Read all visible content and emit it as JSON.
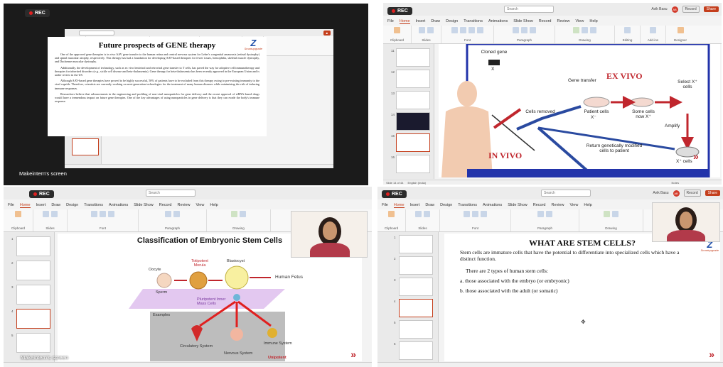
{
  "panel1": {
    "rec_label": "REC",
    "screen_label": "Makeintern's screen",
    "slide": {
      "title": "Future prospects of GENE therapy",
      "paragraphs": [
        "One of the approved gene therapies is in vivo AAV gene transfer to the human retina and central nervous system for Leber's congenital amaurosis (retinal dystrophy) and spinal muscular atrophy, respectively. This therapy has had a foundation for developing AAV-based therapies for fewer issues, hemophilia, skeletal muscle dystrophy, and Duchenne muscular dystrophy.",
        "Additionally, the development of technology, such as ex vivo lentiviral and retroviral gene transfer to T cells, has paved the way for adoptive cell immunotherapy and therapies for inherited disorders (e.g., sickle cell disease and beta-thalassemia). Gene therapy for beta-thalassemia has been recently approved in the European Union and is under review in the US.",
        "Although AAV-based gene therapies have proved to be highly successful, 50% of patients have to be excluded from this therapy owing to pre-existing immunity to the viral capsids. Therefore, scientists are currently working on next-generation technologies for the treatment of many human diseases while minimizing the risk of inducing immune responses.",
        "Researchers believe that advancements in the engineering and profiling of non-viral nanoparticles for gene delivery and the recent approval of siRNA-based drugs would have a tremendous impact on future gene therapies. One of the key advantages of using nanoparticles in gene delivery is that they can evade the body's immune response."
      ],
      "logo_text": "Smartupgrade"
    }
  },
  "panel2": {
    "rec_label": "REC",
    "search_placeholder": "Search",
    "user_name": "Avik Basu",
    "record_label": "Record",
    "share_label": "Share",
    "menu": [
      "File",
      "Home",
      "Insert",
      "Draw",
      "Design",
      "Transitions",
      "Animations",
      "Slide Show",
      "Record",
      "Review",
      "View",
      "Help"
    ],
    "ribbon_groups": [
      "Clipboard",
      "Slides",
      "Font",
      "Paragraph",
      "Drawing",
      "Editing",
      "Add-ins",
      "Designer"
    ],
    "slide_numbers": [
      "11",
      "12",
      "13",
      "14",
      "15",
      "16"
    ],
    "slide": {
      "cloned_gene": "Cloned gene",
      "x_mark": "X",
      "gene_transfer": "Gene transfer",
      "ex_vivo": "EX VIVO",
      "select": "Select X⁺ cells",
      "cells_removed": "Cells removed",
      "patient_cells": "Patient cells",
      "x_minus": "X⁻",
      "some_cells": "Some cells now X⁺",
      "amplify": "Amplify",
      "return_text": "Return genetically modified cells to patient",
      "in_vivo": "IN VIVO",
      "x_plus_cells": "X⁺ cells"
    },
    "status_left": "Slide 14 of 44",
    "status_lang": "English (India)",
    "status_notes": "Notes"
  },
  "panel3": {
    "rec_label": "REC",
    "search_placeholder": "Search",
    "menu": [
      "File",
      "Home",
      "Insert",
      "Draw",
      "Design",
      "Transitions",
      "Animations",
      "Slide Show",
      "Record",
      "Review",
      "View",
      "Help"
    ],
    "ribbon_groups": [
      "Clipboard",
      "Slides",
      "Font",
      "Paragraph",
      "Drawing"
    ],
    "slide_numbers": [
      "1",
      "2",
      "3",
      "4",
      "5"
    ],
    "slide": {
      "title": "Classification of Embryonic Stem Cells",
      "oocyte": "Oocyte",
      "sperm": "Sperm",
      "totipotent": "Totipotent Morula",
      "blastocyst": "Blastocyst",
      "human_fetus": "Human Fetus",
      "pluripotent": "Pluripotent Inner Mass Cells",
      "examples": "Examples",
      "circulatory": "Circulatory System",
      "nervous": "Nervous System",
      "immune": "Immune System",
      "unipotent": "Unipotent",
      "logo_text": "Smartupgrade"
    },
    "screen_label": "Makeintern's screen"
  },
  "panel4": {
    "rec_label": "REC",
    "search_placeholder": "Search",
    "user_name": "Avik Basu",
    "record_label": "Record",
    "share_label": "Share",
    "menu": [
      "File",
      "Home",
      "Insert",
      "Draw",
      "Design",
      "Transitions",
      "Animations",
      "Slide Show",
      "Record",
      "Review",
      "View",
      "Help"
    ],
    "ribbon_groups": [
      "Clipboard",
      "Slides",
      "Font",
      "Paragraph",
      "Drawing"
    ],
    "slide_numbers": [
      "1",
      "2",
      "3",
      "4",
      "5",
      "6"
    ],
    "slide": {
      "title": "WHAT ARE STEM CELLS?",
      "intro": "Stem cells are immature cells that have the potential to differentiate into specialized cells which have a distinct function.",
      "types_heading": "There are 2 types of human stem cells:",
      "type_a": "a. those associated with the embryo (or embryonic)",
      "type_b": "b. those associated with the adult (or somatic)",
      "logo_text": "Smartupgrade"
    }
  },
  "colors": {
    "accent": "#c43e1c",
    "rec_dot": "#e02020",
    "slide_red": "#c0262d",
    "logo_blue": "#1f4fa8"
  }
}
